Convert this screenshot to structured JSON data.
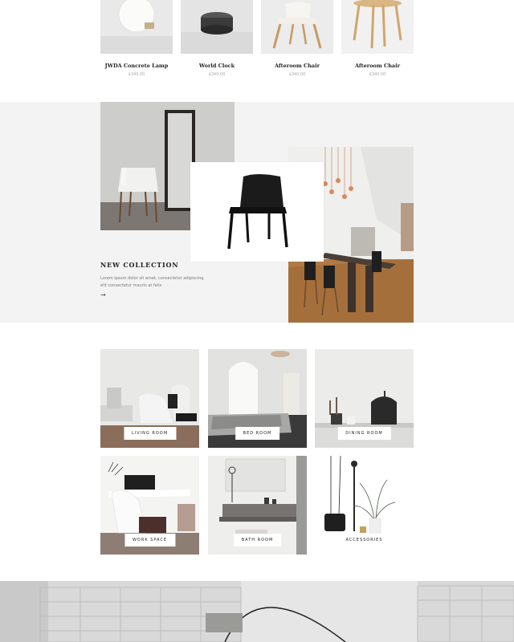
{
  "products": [
    {
      "name": "JWDA Concrete Lamp",
      "price": "$340.00"
    },
    {
      "name": "World Clock",
      "price": "$340.00"
    },
    {
      "name": "Afteroom Chair",
      "price": "$340.00"
    },
    {
      "name": "Afteroom Chair",
      "price": "$340.00"
    }
  ],
  "collection": {
    "title": "NEW COLLECTION",
    "text": "Lorem ipsum dolor sit amet, consectetur adipiscing elit consectetur mauris at felis",
    "arrow": "→"
  },
  "rooms": [
    {
      "label": "LIVING ROOM"
    },
    {
      "label": "BED ROOM"
    },
    {
      "label": "DINING ROOM"
    },
    {
      "label": "WORK SPACE"
    },
    {
      "label": "BATH ROOM"
    },
    {
      "label": "ACCESSORIES"
    }
  ]
}
